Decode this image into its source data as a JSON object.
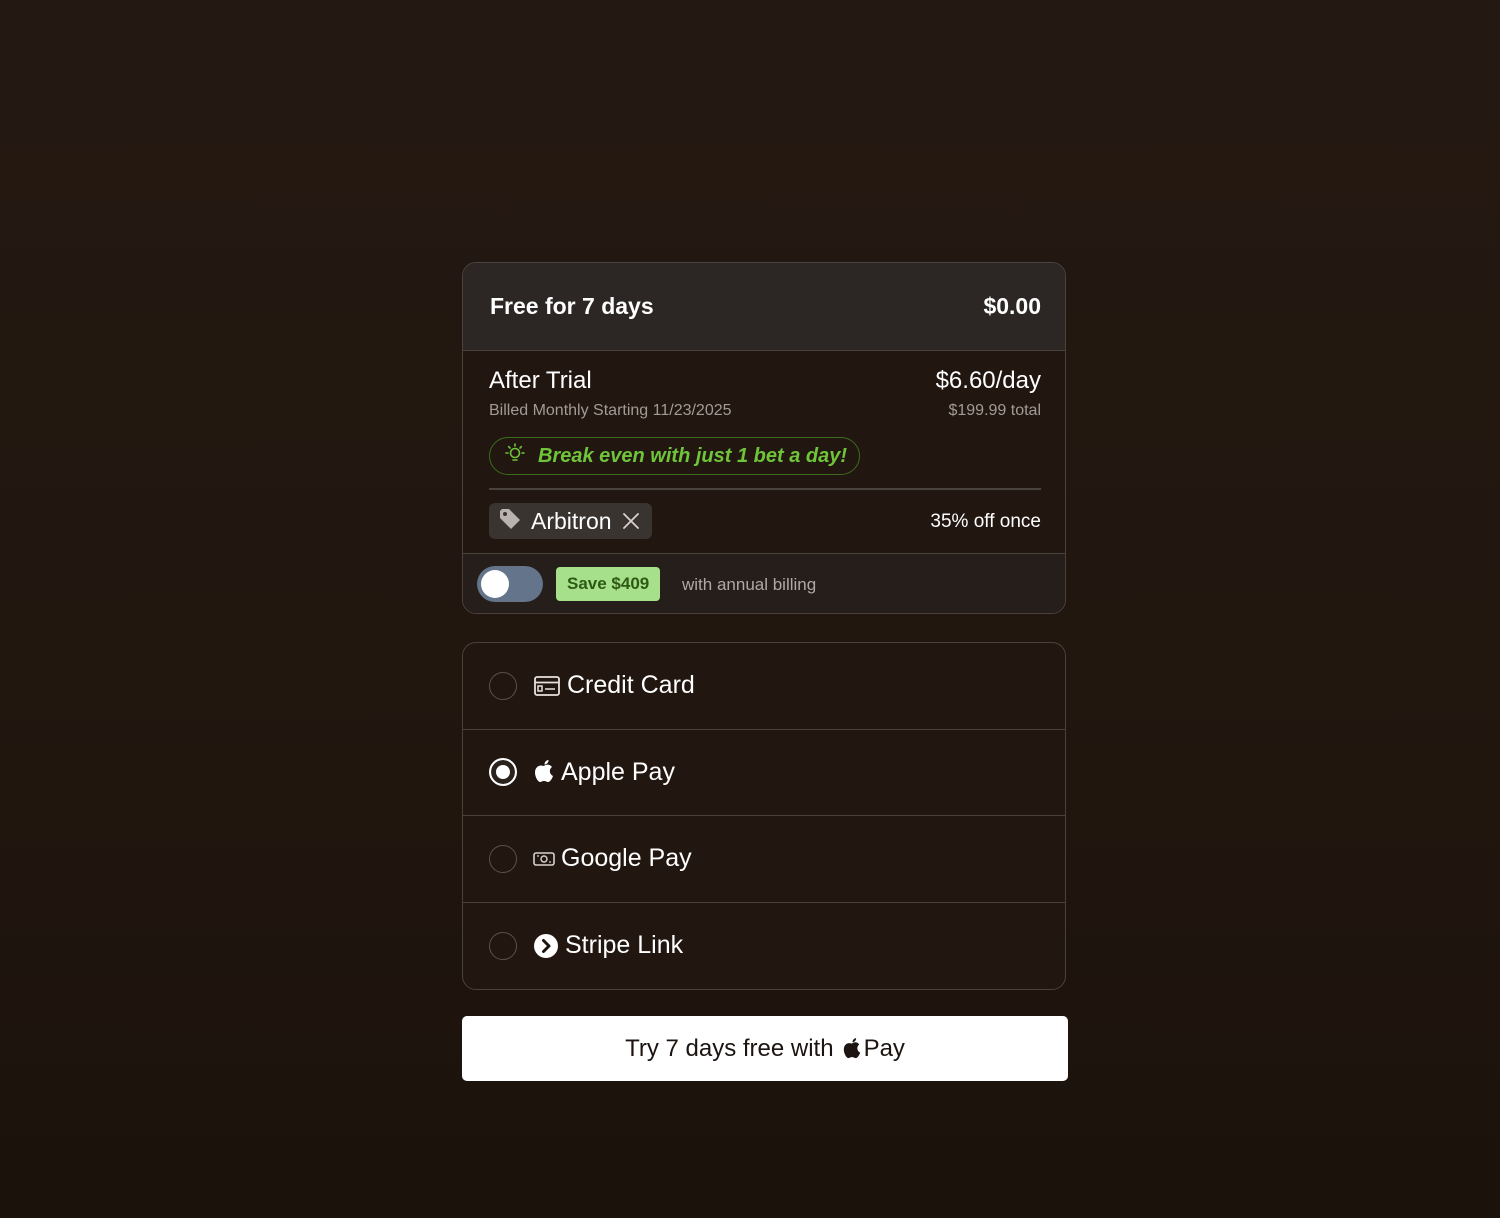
{
  "summary": {
    "trial_title": "Free for 7 days",
    "trial_price": "$0.00",
    "after_trial_title": "After Trial",
    "after_trial_price": "$6.60/day",
    "billed_text": "Billed Monthly Starting 11/23/2025",
    "total_text": "$199.99 total",
    "break_even_text": "Break even with just 1 bet a day!",
    "coupon_code": "Arbitron",
    "discount_text": "35% off once"
  },
  "annual": {
    "toggle_on": false,
    "save_badge": "Save $409",
    "label": "with annual billing"
  },
  "payment": {
    "selected": "apple-pay",
    "options": [
      {
        "id": "credit-card",
        "label": "Credit Card",
        "icon": "credit-card-icon"
      },
      {
        "id": "apple-pay",
        "label": "Apple Pay",
        "icon": "apple-icon"
      },
      {
        "id": "google-pay",
        "label": "Google Pay",
        "icon": "google-pay-icon"
      },
      {
        "id": "stripe-link",
        "label": "Stripe Link",
        "icon": "stripe-link-icon"
      }
    ]
  },
  "cta": {
    "prefix": "Try 7 days free with",
    "suffix": "Pay",
    "icon": "apple-icon"
  },
  "colors": {
    "accent_green": "#6fc43a",
    "badge_green": "#a7e08a",
    "background": "#241812"
  }
}
